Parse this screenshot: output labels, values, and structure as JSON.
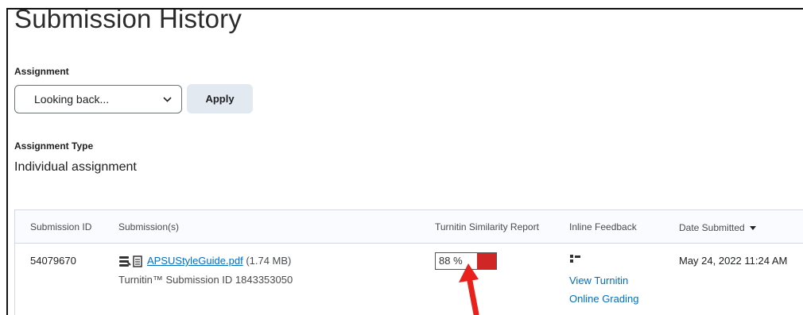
{
  "page": {
    "title": "Submission History"
  },
  "assignment": {
    "label": "Assignment",
    "selected": "Looking back...",
    "apply_label": "Apply"
  },
  "assignment_type": {
    "label": "Assignment Type",
    "value": "Individual assignment"
  },
  "table": {
    "headers": {
      "submission_id": "Submission ID",
      "submissions": "Submission(s)",
      "similarity": "Turnitin Similarity Report",
      "inline_feedback": "Inline Feedback",
      "date_submitted": "Date Submitted"
    },
    "rows": [
      {
        "submission_id": "54079670",
        "file_name": "APSUStyleGuide.pdf",
        "file_size": "(1.74 MB)",
        "turnitin_id": "Turnitin™ Submission ID 1843353050",
        "similarity_text": "88 %",
        "similarity_percent": 88,
        "similarity_color": "#d02626",
        "feedback_line1": "View Turnitin",
        "feedback_line2": "Online Grading",
        "date": "May 24, 2022 11:24 AM"
      }
    ]
  },
  "icons": {
    "sort": "caret-down-icon",
    "file": "document-icon",
    "stack": "stack-icon",
    "feedback": "grading-icon",
    "annotation": "red-arrow-icon"
  },
  "colors": {
    "link": "#006fbf",
    "accent_red": "#d02626",
    "annotation_arrow": "#e8211d"
  }
}
